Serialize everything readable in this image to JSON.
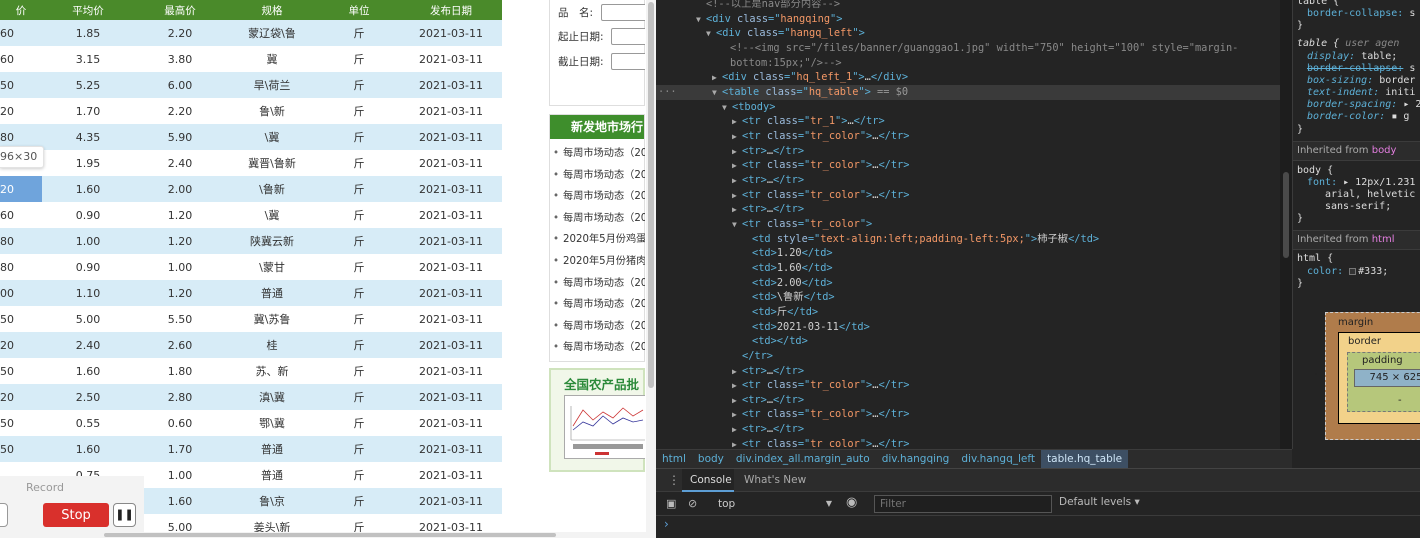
{
  "webpage": {
    "table": {
      "headers": [
        "价",
        "平均价",
        "最高价",
        "规格",
        "单位",
        "发布日期"
      ],
      "rows": [
        [
          "60",
          "1.85",
          "2.20",
          "蒙辽袋\\鲁",
          "斤",
          "2021-03-11"
        ],
        [
          "60",
          "3.15",
          "3.80",
          "冀",
          "斤",
          "2021-03-11"
        ],
        [
          "50",
          "5.25",
          "6.00",
          "旱\\荷兰",
          "斤",
          "2021-03-11"
        ],
        [
          "20",
          "1.70",
          "2.20",
          "鲁\\新",
          "斤",
          "2021-03-11"
        ],
        [
          "80",
          "4.35",
          "5.90",
          "\\冀",
          "斤",
          "2021-03-11"
        ],
        [
          "",
          "1.95",
          "2.40",
          "冀晋\\鲁新",
          "斤",
          "2021-03-11"
        ],
        [
          "20",
          "1.60",
          "2.00",
          "\\鲁新",
          "斤",
          "2021-03-11"
        ],
        [
          "60",
          "0.90",
          "1.20",
          "\\冀",
          "斤",
          "2021-03-11"
        ],
        [
          "80",
          "1.00",
          "1.20",
          "陕冀云新",
          "斤",
          "2021-03-11"
        ],
        [
          "80",
          "0.90",
          "1.00",
          "\\蒙甘",
          "斤",
          "2021-03-11"
        ],
        [
          "00",
          "1.10",
          "1.20",
          "普通",
          "斤",
          "2021-03-11"
        ],
        [
          "50",
          "5.00",
          "5.50",
          "冀\\苏鲁",
          "斤",
          "2021-03-11"
        ],
        [
          "20",
          "2.40",
          "2.60",
          "桂",
          "斤",
          "2021-03-11"
        ],
        [
          "50",
          "1.60",
          "1.80",
          "苏、新",
          "斤",
          "2021-03-11"
        ],
        [
          "20",
          "2.50",
          "2.80",
          "滇\\冀",
          "斤",
          "2021-03-11"
        ],
        [
          "50",
          "0.55",
          "0.60",
          "鄂\\冀",
          "斤",
          "2021-03-11"
        ],
        [
          "50",
          "1.60",
          "1.70",
          "普通",
          "斤",
          "2021-03-11"
        ],
        [
          "",
          "0.75",
          "1.00",
          "普通",
          "斤",
          "2021-03-11"
        ],
        [
          "",
          "1.60",
          "1.60",
          "鲁\\京",
          "斤",
          "2021-03-11"
        ],
        [
          "",
          "",
          "5.00",
          "姜头\\新",
          "斤",
          "2021-03-11"
        ]
      ]
    },
    "dim_tooltip": "96×30",
    "recorder": {
      "label": "Record",
      "stop": "Stop",
      "pause": "❚❚"
    },
    "search_form": {
      "name_label": "品　名:",
      "start_label": "起止日期:",
      "end_label": "截止日期:"
    },
    "market_box": {
      "title": "新发地市场行",
      "news": [
        "每周市场动态（20",
        "每周市场动态（20",
        "每周市场动态（20",
        "每周市场动态（20",
        "2020年5月份鸡蛋",
        "2020年5月份猪肉",
        "每周市场动态（20",
        "每周市场动态（20",
        "每周市场动态（20",
        "每周市场动态（20"
      ]
    },
    "banner": {
      "title": "全国农产品批"
    }
  },
  "devtools": {
    "dom": [
      {
        "i": 40,
        "arrow": "",
        "html": "<span class='c'>&lt;!--以上是nav部分内容--&gt;</span>"
      },
      {
        "i": 40,
        "arrow": "▼",
        "html": "<span class='t'>&lt;div</span> <span class='a'>class</span><span class='t'>=\"</span><span class='v'>hangqing</span><span class='t'>\"&gt;</span>"
      },
      {
        "i": 50,
        "arrow": "▼",
        "html": "<span class='t'>&lt;div</span> <span class='a'>class</span><span class='t'>=\"</span><span class='v'>hangq_left</span><span class='t'>\"&gt;</span>"
      },
      {
        "i": 64,
        "arrow": "",
        "html": "<span class='c'>&lt;!--&lt;img src=\"/files/banner/guanggao1.jpg\" width=\"750\" height=\"100\" style=\"margin-</span>"
      },
      {
        "i": 64,
        "arrow": "",
        "html": "<span class='c'>bottom:15px;\"/&gt;--&gt;</span>"
      },
      {
        "i": 56,
        "arrow": "▶",
        "html": "<span class='t'>&lt;div</span> <span class='a'>class</span><span class='t'>=\"</span><span class='v'>hq_left_1</span><span class='t'>\"&gt;</span><span class='tx'>…</span><span class='t'>&lt;/div&gt;</span>"
      },
      {
        "i": 56,
        "arrow": "▼",
        "sel": true,
        "html": "<span class='t'>&lt;table</span> <span class='a'>class</span><span class='t'>=\"</span><span class='v'>hq_table</span><span class='t'>\"&gt;</span> <span class='eq'>== $0</span>"
      },
      {
        "i": 66,
        "arrow": "▼",
        "html": "<span class='t'>&lt;tbody&gt;</span>"
      },
      {
        "i": 76,
        "arrow": "▶",
        "html": "<span class='t'>&lt;tr</span> <span class='a'>class</span><span class='t'>=\"</span><span class='v'>tr_1</span><span class='t'>\"&gt;</span><span class='tx'>…</span><span class='t'>&lt;/tr&gt;</span>"
      },
      {
        "i": 76,
        "arrow": "▶",
        "html": "<span class='t'>&lt;tr</span> <span class='a'>class</span><span class='t'>=\"</span><span class='v'>tr_color</span><span class='t'>\"&gt;</span><span class='tx'>…</span><span class='t'>&lt;/tr&gt;</span>"
      },
      {
        "i": 76,
        "arrow": "▶",
        "html": "<span class='t'>&lt;tr&gt;</span><span class='tx'>…</span><span class='t'>&lt;/tr&gt;</span>"
      },
      {
        "i": 76,
        "arrow": "▶",
        "html": "<span class='t'>&lt;tr</span> <span class='a'>class</span><span class='t'>=\"</span><span class='v'>tr_color</span><span class='t'>\"&gt;</span><span class='tx'>…</span><span class='t'>&lt;/tr&gt;</span>"
      },
      {
        "i": 76,
        "arrow": "▶",
        "html": "<span class='t'>&lt;tr&gt;</span><span class='tx'>…</span><span class='t'>&lt;/tr&gt;</span>"
      },
      {
        "i": 76,
        "arrow": "▶",
        "html": "<span class='t'>&lt;tr</span> <span class='a'>class</span><span class='t'>=\"</span><span class='v'>tr_color</span><span class='t'>\"&gt;</span><span class='tx'>…</span><span class='t'>&lt;/tr&gt;</span>"
      },
      {
        "i": 76,
        "arrow": "▶",
        "html": "<span class='t'>&lt;tr&gt;</span><span class='tx'>…</span><span class='t'>&lt;/tr&gt;</span>"
      },
      {
        "i": 76,
        "arrow": "▼",
        "html": "<span class='t'>&lt;tr</span> <span class='a'>class</span><span class='t'>=\"</span><span class='v'>tr_color</span><span class='t'>\"&gt;</span>"
      },
      {
        "i": 86,
        "arrow": "",
        "html": "<span class='t'>&lt;td</span> <span class='a'>style</span><span class='t'>=\"</span><span class='v'>text-align:left;padding-left:5px;</span><span class='t'>\"&gt;</span><span class='tx'>柿子椒</span><span class='t'>&lt;/td&gt;</span>"
      },
      {
        "i": 86,
        "arrow": "",
        "html": "<span class='t'>&lt;td&gt;</span><span class='tx'>1.20</span><span class='t'>&lt;/td&gt;</span>"
      },
      {
        "i": 86,
        "arrow": "",
        "html": "<span class='t'>&lt;td&gt;</span><span class='tx'>1.60</span><span class='t'>&lt;/td&gt;</span>"
      },
      {
        "i": 86,
        "arrow": "",
        "html": "<span class='t'>&lt;td&gt;</span><span class='tx'>2.00</span><span class='t'>&lt;/td&gt;</span>"
      },
      {
        "i": 86,
        "arrow": "",
        "html": "<span class='t'>&lt;td&gt;</span><span class='tx'>\\鲁新</span><span class='t'>&lt;/td&gt;</span>"
      },
      {
        "i": 86,
        "arrow": "",
        "html": "<span class='t'>&lt;td&gt;</span><span class='tx'>斤</span><span class='t'>&lt;/td&gt;</span>"
      },
      {
        "i": 86,
        "arrow": "",
        "html": "<span class='t'>&lt;td&gt;</span><span class='tx'>2021-03-11</span><span class='t'>&lt;/td&gt;</span>"
      },
      {
        "i": 86,
        "arrow": "",
        "html": "<span class='t'>&lt;td&gt;&lt;/td&gt;</span>"
      },
      {
        "i": 76,
        "arrow": "",
        "html": "<span class='t'>&lt;/tr&gt;</span>"
      },
      {
        "i": 76,
        "arrow": "▶",
        "html": "<span class='t'>&lt;tr&gt;</span><span class='tx'>…</span><span class='t'>&lt;/tr&gt;</span>"
      },
      {
        "i": 76,
        "arrow": "▶",
        "html": "<span class='t'>&lt;tr</span> <span class='a'>class</span><span class='t'>=\"</span><span class='v'>tr_color</span><span class='t'>\"&gt;</span><span class='tx'>…</span><span class='t'>&lt;/tr&gt;</span>"
      },
      {
        "i": 76,
        "arrow": "▶",
        "html": "<span class='t'>&lt;tr&gt;</span><span class='tx'>…</span><span class='t'>&lt;/tr&gt;</span>"
      },
      {
        "i": 76,
        "arrow": "▶",
        "html": "<span class='t'>&lt;tr</span> <span class='a'>class</span><span class='t'>=\"</span><span class='v'>tr_color</span><span class='t'>\"&gt;</span><span class='tx'>…</span><span class='t'>&lt;/tr&gt;</span>"
      },
      {
        "i": 76,
        "arrow": "▶",
        "html": "<span class='t'>&lt;tr&gt;</span><span class='tx'>…</span><span class='t'>&lt;/tr&gt;</span>"
      },
      {
        "i": 76,
        "arrow": "▶",
        "html": "<span class='t'>&lt;tr</span> <span class='a'>class</span><span class='t'>=\"</span><span class='v'>tr_color</span><span class='t'>\"&gt;</span><span class='tx'>…</span><span class='t'>&lt;/tr&gt;</span>"
      }
    ],
    "breadcrumb": [
      "html",
      "body",
      "div.index_all.margin_auto",
      "div.hangqing",
      "div.hangq_left",
      "table.hq_table"
    ],
    "styles": {
      "rule1_prop": "border-collapse:",
      "rule1_val": "s",
      "ua_selector": "table {",
      "ua_label": "user agen",
      "ua_props": [
        {
          "p": "display:",
          "v": "table;",
          "cls": "ua"
        },
        {
          "p": "border-collapse:",
          "v": "s",
          "cls": "struck"
        },
        {
          "p": "box-sizing:",
          "v": "border",
          "cls": "ua"
        },
        {
          "p": "text-indent:",
          "v": "initi",
          "cls": "ua"
        },
        {
          "p": "border-spacing:",
          "v": "▸ 2",
          "cls": "ua"
        },
        {
          "p": "border-color:",
          "v": "▪ g",
          "cls": "ua"
        }
      ],
      "inherited_body": "Inherited from ",
      "inherited_body_sel": "body",
      "body_selector": "body {",
      "body_font_prop": "font:",
      "body_font_val": "▸ 12px/1.231",
      "body_font_cont1": "arial, helvetic",
      "body_font_cont2": "sans-serif;",
      "inherited_html": "Inherited from ",
      "inherited_html_sel": "html",
      "html_selector": "html {",
      "html_color_prop": "color:",
      "html_color_val": "#333;",
      "box_margin": "margin",
      "box_border": "border",
      "box_padding": "padding",
      "box_content": "745 × 625",
      "box_dash": "-"
    },
    "console": {
      "tab_console": "Console",
      "tab_whatsnew": "What's New",
      "context": "top",
      "filter_placeholder": "Filter",
      "levels": "Default levels ▾",
      "prompt": "›"
    }
  },
  "colors": {
    "table_header": "#4a8a2a",
    "row_shade": "#d7ecf7",
    "row_highlight": "#6fa4dc",
    "stop_button": "#d9302c",
    "devtools_bg": "#242424"
  }
}
